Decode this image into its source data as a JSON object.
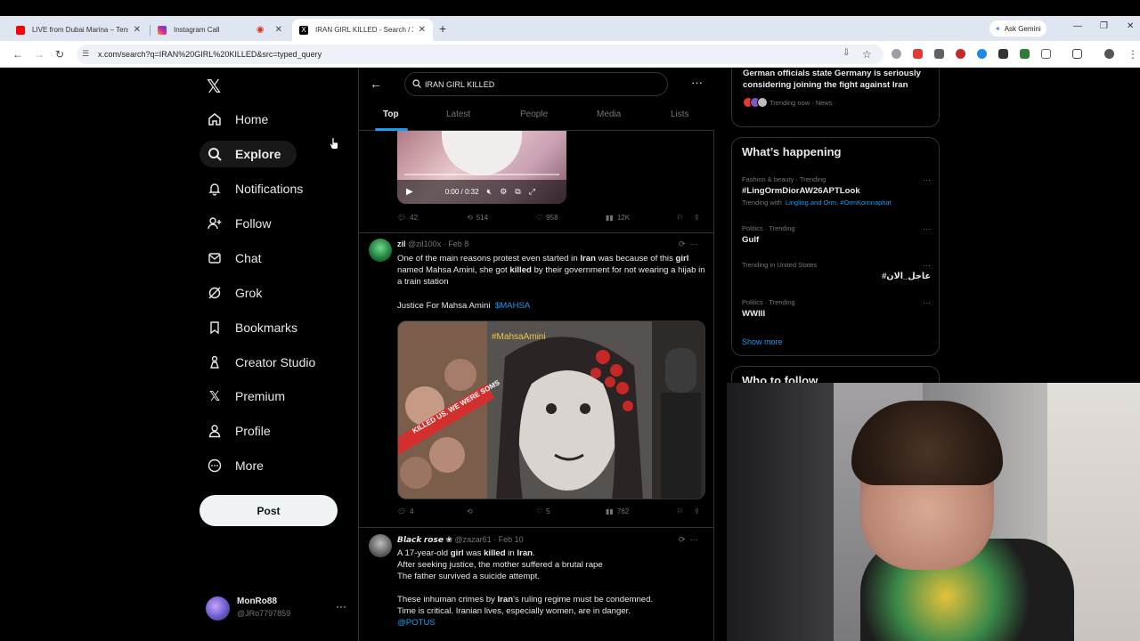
{
  "browser": {
    "tabs": [
      {
        "title": "LIVE from Dubai Marina – Tensi",
        "favicon": "youtube-icon",
        "color": "#ff0000"
      },
      {
        "title": "Instagram Call",
        "favicon": "instagram-icon",
        "color": "#d6249f"
      },
      {
        "title": "IRAN GIRL KILLED - Search / X",
        "favicon": "x-icon",
        "color": "#000000"
      }
    ],
    "gemini_label": "Ask Gemini",
    "url": "x.com/search?q=IRAN%20GIRL%20KILLED&src=typed_query"
  },
  "nav": {
    "items": [
      {
        "label": "Home",
        "icon": "home-icon"
      },
      {
        "label": "Explore",
        "icon": "search-icon"
      },
      {
        "label": "Notifications",
        "icon": "bell-icon"
      },
      {
        "label": "Follow",
        "icon": "person-add-icon"
      },
      {
        "label": "Chat",
        "icon": "mail-icon"
      },
      {
        "label": "Grok",
        "icon": "grok-icon"
      },
      {
        "label": "Bookmarks",
        "icon": "bookmark-icon"
      },
      {
        "label": "Creator Studio",
        "icon": "creator-icon"
      },
      {
        "label": "Premium",
        "icon": "x-icon"
      },
      {
        "label": "Profile",
        "icon": "person-icon"
      },
      {
        "label": "More",
        "icon": "more-circle-icon"
      }
    ],
    "active": "Explore",
    "post_label": "Post",
    "account": {
      "name": "MonRo88",
      "handle": "@JRo7797859"
    }
  },
  "search": {
    "query": "IRAN GIRL KILLED",
    "tabs": [
      "Top",
      "Latest",
      "People",
      "Media",
      "Lists"
    ],
    "active_tab": "Top"
  },
  "video": {
    "time": "0:00 / 0:32"
  },
  "tweet0": {
    "replies": "42",
    "reposts": "514",
    "likes": "958",
    "views": "12K"
  },
  "tweet1": {
    "name": "zil",
    "handle": "@zil100x",
    "date": "· Feb 8",
    "text": [
      "One of the main reasons protest even started in ",
      "Iran",
      " was because of this ",
      "girl",
      " named Mahsa Amini, she got ",
      "killed",
      " by their government for not wearing a hijab in a train station"
    ],
    "line2": "Justice For Mahsa Amini",
    "cashtag": "$MAHSA",
    "image_text": "#MahsaAmini",
    "image_banner": "KILLED US. WE WERE SOMS",
    "replies": "4",
    "reposts": "",
    "likes": "5",
    "views": "762"
  },
  "tweet2": {
    "name": "𝘽𝙡𝙖𝙘𝙠 𝙧𝙤𝙨𝙚 ❀",
    "handle": "@zazar61",
    "date": "· Feb 10",
    "line1": [
      "A 17-year-old ",
      "girl",
      " was ",
      "killed",
      " in ",
      "Iran",
      "."
    ],
    "line2": "After seeking justice, the mother suffered a brutal rape",
    "line3": "The father survived a suicide attempt.",
    "line4": [
      "These inhuman crimes by ",
      "Iran",
      "'s ruling regime must be condemned."
    ],
    "line5": "Time is critical. Iranian lives, especially women, are in danger.",
    "mention": "@POTUS"
  },
  "news": {
    "title": "German officials state Germany is seriously considering joining the fight against Iran",
    "meta": "Trending now · News ·"
  },
  "whats_happening": {
    "title": "What’s happening",
    "trends": [
      {
        "meta": "Fashion & beauty · Trending",
        "name": "#LingOrmDiorAW26APTLook",
        "with_label": "Trending with",
        "with": "Lingling and Orm, #OrmKornnaphat"
      },
      {
        "meta": "Politics · Trending",
        "name": "Gulf"
      },
      {
        "meta": "Trending in United States",
        "name": "#عاجل_الان"
      },
      {
        "meta": "Politics · Trending",
        "name": "WWIII"
      }
    ],
    "show_more": "Show more"
  },
  "who_to_follow": {
    "title": "Who to follow"
  },
  "colors": {
    "accent": "#1d9bf0",
    "border": "#2f3336",
    "muted": "#71767b",
    "text": "#e7e9ea"
  }
}
